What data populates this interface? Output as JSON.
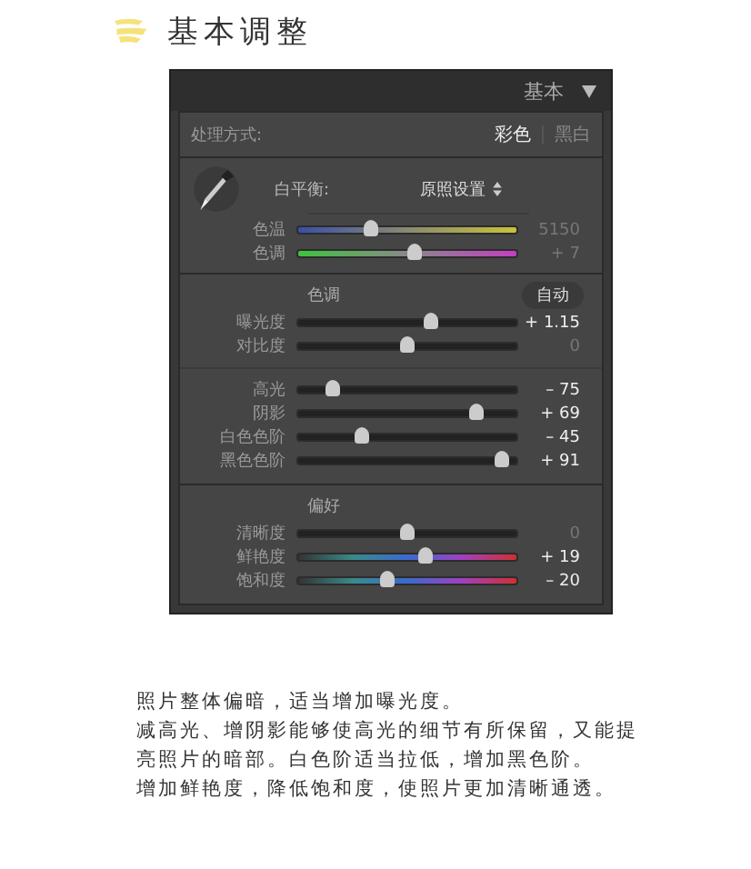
{
  "heading": "基本调整",
  "panel": {
    "title": "基本",
    "treatment": {
      "label": "处理方式:",
      "options": [
        {
          "label": "彩色",
          "selected": true
        },
        {
          "label": "黑白",
          "selected": false
        }
      ]
    },
    "white_balance": {
      "label": "白平衡:",
      "value": "原照设置",
      "sliders": [
        {
          "label": "色温",
          "level": 0.33,
          "reading": "5150",
          "emphasized": false,
          "kind": "temp"
        },
        {
          "label": "色调",
          "level": 0.53,
          "reading": "+ 7",
          "emphasized": false,
          "kind": "tint"
        }
      ]
    },
    "tone": {
      "label": "色调",
      "auto": "自动",
      "groups": [
        [
          {
            "label": "曝光度",
            "level": 0.61,
            "reading": "+ 1.15",
            "emphasized": true,
            "kind": "plain"
          },
          {
            "label": "对比度",
            "level": 0.5,
            "reading": "0",
            "emphasized": false,
            "kind": "plain"
          }
        ],
        [
          {
            "label": "高光",
            "level": 0.16,
            "reading": "– 75",
            "emphasized": true,
            "kind": "plain"
          },
          {
            "label": "阴影",
            "level": 0.82,
            "reading": "+ 69",
            "emphasized": true,
            "kind": "plain"
          },
          {
            "label": "白色色阶",
            "level": 0.29,
            "reading": "– 45",
            "emphasized": true,
            "kind": "plain"
          },
          {
            "label": "黑色色阶",
            "level": 0.93,
            "reading": "+ 91",
            "emphasized": true,
            "kind": "plain"
          }
        ]
      ]
    },
    "presence": {
      "label": "偏好",
      "sliders": [
        {
          "label": "清晰度",
          "level": 0.5,
          "reading": "0",
          "emphasized": false,
          "kind": "plain"
        },
        {
          "label": "鲜艳度",
          "level": 0.58,
          "reading": "+ 19",
          "emphasized": true,
          "kind": "spectrum"
        },
        {
          "label": "饱和度",
          "level": 0.41,
          "reading": "– 20",
          "emphasized": true,
          "kind": "spectrum"
        }
      ]
    }
  },
  "notes": [
    "照片整体偏暗，适当增加曝光度。",
    "减高光、增阴影能够使高光的细节有所保留，又能提亮照片的暗部。白色阶适当拉低，增加黑色阶。",
    "增加鲜艳度，降低饱和度，使照片更加清晰通透。"
  ]
}
